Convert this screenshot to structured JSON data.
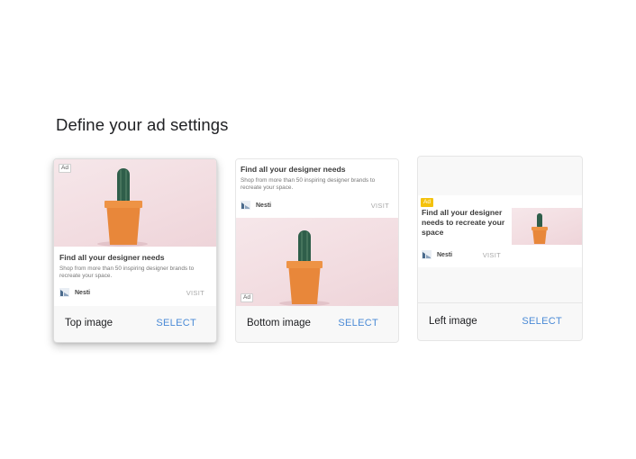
{
  "page": {
    "title": "Define your ad settings"
  },
  "ad": {
    "badge": "Ad",
    "headline": "Find all your designer needs",
    "description": "Shop from more than 50 inspiring designer brands to recreate your space.",
    "left_headline": "Find all your designer needs to recreate your space",
    "brand": "Nesti",
    "visit": "VISIT"
  },
  "cards": [
    {
      "format_label": "Top image",
      "select_label": "SELECT",
      "selected": true
    },
    {
      "format_label": "Bottom image",
      "select_label": "SELECT",
      "selected": false
    },
    {
      "format_label": "Left image",
      "select_label": "SELECT",
      "selected": false
    }
  ],
  "icons": {
    "logo": "nesti-logo-icon",
    "image": "cactus-pot-image"
  },
  "colors": {
    "select": "#4a8ad6",
    "ad_badge_yellow": "#f4c20d",
    "pot": "#e8873a",
    "cactus": "#2f5e4a"
  }
}
